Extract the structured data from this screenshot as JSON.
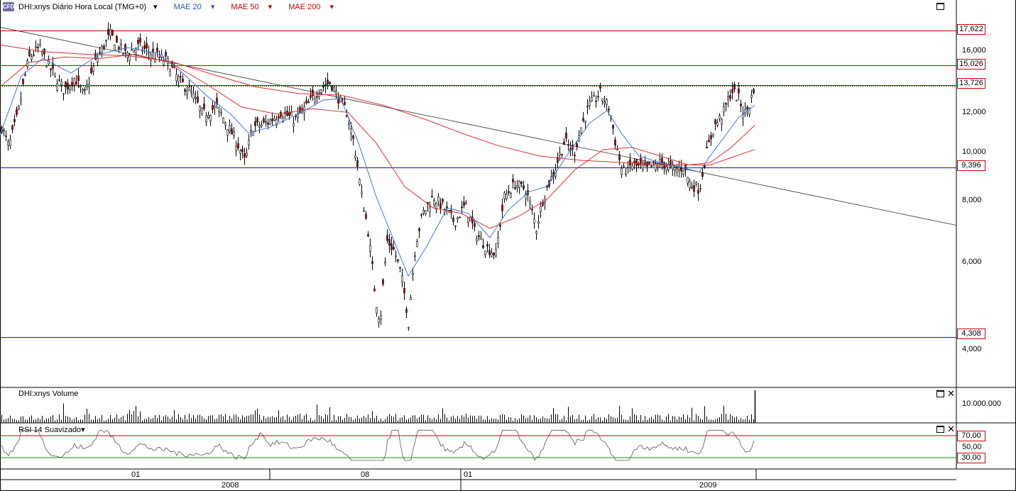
{
  "header": {
    "logo": "CFD",
    "symbol_label": "DHI:xnys Diário Hora Local (TMG+0)",
    "ma20_label": "MAE 20",
    "ma50_label": "MAE 50",
    "ma200_label": "MAE 200",
    "colors": {
      "ma20": "#4477dd",
      "ma50": "#e03030",
      "ma200": "#e03030",
      "candle_down": "#aa0000"
    }
  },
  "volume_pane": {
    "title": "DHI:xnys Volume",
    "tick": "10.000.000"
  },
  "rsi_pane": {
    "title": "RSI 14 Suavizado",
    "ticks": [
      "70,00",
      "50,00",
      "30,00"
    ]
  },
  "price_tags": [
    "17,622",
    "15,026",
    "13,726",
    "9,396",
    "4,308"
  ],
  "y_ticks": [
    "16,000",
    "12,000",
    "10,000",
    "8,000",
    "6,000",
    "4,000"
  ],
  "x_axis": {
    "months": [
      "01",
      "08",
      "01"
    ],
    "years": [
      "2008",
      "2009"
    ]
  },
  "chart_data": {
    "type": "candlestick",
    "scale": "log",
    "ylim": [
      3.6,
      19.0
    ],
    "horizontal_levels": [
      {
        "value": 17.622,
        "color": "#cc0000"
      },
      {
        "value": 15.026,
        "color": "#cc0000"
      },
      {
        "value": 13.726,
        "color": "#cc0000"
      },
      {
        "value": 9.396,
        "color": "#1a1a8a"
      },
      {
        "value": 4.308,
        "color": "#1a1a8a"
      }
    ],
    "close_path": [
      [
        0,
        11.5
      ],
      [
        12,
        10.3
      ],
      [
        25,
        12.0
      ],
      [
        40,
        15.5
      ],
      [
        55,
        16.3
      ],
      [
        70,
        14.8
      ],
      [
        90,
        13.4
      ],
      [
        105,
        14.2
      ],
      [
        118,
        13.0
      ],
      [
        135,
        15.4
      ],
      [
        155,
        17.3
      ],
      [
        175,
        15.8
      ],
      [
        195,
        16.4
      ],
      [
        215,
        15.8
      ],
      [
        235,
        15.3
      ],
      [
        252,
        14.0
      ],
      [
        268,
        13.3
      ],
      [
        285,
        12.0
      ],
      [
        305,
        12.4
      ],
      [
        320,
        11.4
      ],
      [
        335,
        10.4
      ],
      [
        345,
        9.6
      ],
      [
        355,
        11.3
      ],
      [
        375,
        11.5
      ],
      [
        395,
        12.1
      ],
      [
        415,
        11.7
      ],
      [
        435,
        12.6
      ],
      [
        450,
        13.5
      ],
      [
        465,
        13.9
      ],
      [
        475,
        13.0
      ],
      [
        488,
        12.1
      ],
      [
        498,
        10.5
      ],
      [
        508,
        8.4
      ],
      [
        518,
        7.0
      ],
      [
        528,
        5.2
      ],
      [
        535,
        4.6
      ],
      [
        545,
        6.7
      ],
      [
        555,
        6.4
      ],
      [
        565,
        5.7
      ],
      [
        575,
        4.6
      ],
      [
        585,
        6.6
      ],
      [
        595,
        7.6
      ],
      [
        610,
        8.2
      ],
      [
        625,
        7.8
      ],
      [
        640,
        7.3
      ],
      [
        655,
        7.9
      ],
      [
        668,
        7.0
      ],
      [
        685,
        6.5
      ],
      [
        698,
        6.3
      ],
      [
        710,
        8.2
      ],
      [
        725,
        8.7
      ],
      [
        740,
        8.5
      ],
      [
        755,
        7.1
      ],
      [
        765,
        8.2
      ],
      [
        780,
        9.2
      ],
      [
        795,
        10.6
      ],
      [
        808,
        10.0
      ],
      [
        818,
        11.3
      ],
      [
        830,
        12.5
      ],
      [
        845,
        13.2
      ],
      [
        858,
        12.3
      ],
      [
        866,
        10.6
      ],
      [
        876,
        9.2
      ],
      [
        890,
        9.5
      ],
      [
        910,
        9.3
      ],
      [
        930,
        9.6
      ],
      [
        950,
        9.3
      ],
      [
        962,
        9.4
      ],
      [
        972,
        8.7
      ],
      [
        985,
        8.5
      ],
      [
        993,
        9.8
      ],
      [
        1005,
        11.3
      ],
      [
        1018,
        12.0
      ],
      [
        1030,
        13.4
      ],
      [
        1040,
        12.9
      ],
      [
        1048,
        12.0
      ],
      [
        1056,
        12.6
      ],
      [
        1063,
        13.9
      ]
    ],
    "ma20": [
      [
        0,
        10.9
      ],
      [
        30,
        14.3
      ],
      [
        60,
        15.5
      ],
      [
        100,
        14.5
      ],
      [
        140,
        15.8
      ],
      [
        180,
        16.3
      ],
      [
        220,
        15.9
      ],
      [
        255,
        14.6
      ],
      [
        290,
        13.1
      ],
      [
        325,
        12.0
      ],
      [
        350,
        11.0
      ],
      [
        380,
        11.3
      ],
      [
        420,
        12.0
      ],
      [
        455,
        12.8
      ],
      [
        480,
        12.9
      ],
      [
        505,
        10.5
      ],
      [
        530,
        8.2
      ],
      [
        555,
        6.7
      ],
      [
        575,
        5.7
      ],
      [
        600,
        6.5
      ],
      [
        630,
        7.8
      ],
      [
        660,
        7.6
      ],
      [
        690,
        6.8
      ],
      [
        715,
        7.7
      ],
      [
        745,
        8.4
      ],
      [
        770,
        8.6
      ],
      [
        800,
        10.0
      ],
      [
        830,
        11.5
      ],
      [
        855,
        12.2
      ],
      [
        875,
        11.0
      ],
      [
        900,
        9.9
      ],
      [
        930,
        9.6
      ],
      [
        960,
        9.4
      ],
      [
        985,
        9.2
      ],
      [
        1000,
        9.9
      ],
      [
        1020,
        10.8
      ],
      [
        1040,
        11.8
      ],
      [
        1063,
        12.5
      ]
    ],
    "ma50": [
      [
        0,
        13.6
      ],
      [
        40,
        15.2
      ],
      [
        90,
        15.6
      ],
      [
        140,
        15.5
      ],
      [
        190,
        15.8
      ],
      [
        240,
        15.2
      ],
      [
        290,
        13.8
      ],
      [
        340,
        12.4
      ],
      [
        390,
        12.0
      ],
      [
        440,
        12.3
      ],
      [
        490,
        12.1
      ],
      [
        530,
        10.5
      ],
      [
        570,
        8.6
      ],
      [
        610,
        7.8
      ],
      [
        650,
        7.6
      ],
      [
        690,
        7.1
      ],
      [
        730,
        7.5
      ],
      [
        770,
        8.1
      ],
      [
        810,
        9.3
      ],
      [
        850,
        10.2
      ],
      [
        890,
        10.3
      ],
      [
        930,
        9.9
      ],
      [
        970,
        9.5
      ],
      [
        1000,
        9.6
      ],
      [
        1030,
        10.3
      ],
      [
        1063,
        11.4
      ]
    ],
    "ma200": [
      [
        0,
        16.5
      ],
      [
        60,
        16.0
      ],
      [
        120,
        15.8
      ],
      [
        180,
        15.7
      ],
      [
        240,
        15.3
      ],
      [
        300,
        14.4
      ],
      [
        360,
        13.6
      ],
      [
        420,
        13.2
      ],
      [
        480,
        13.1
      ],
      [
        540,
        12.5
      ],
      [
        600,
        11.7
      ],
      [
        650,
        11.0
      ],
      [
        700,
        10.4
      ],
      [
        760,
        9.9
      ],
      [
        820,
        9.7
      ],
      [
        880,
        9.6
      ],
      [
        940,
        9.5
      ],
      [
        1000,
        9.5
      ],
      [
        1063,
        10.2
      ]
    ],
    "trendline": {
      "start": [
        0,
        17.9
      ],
      "end": [
        1347,
        7.2
      ]
    },
    "volume_spike_bar": 1063
  }
}
